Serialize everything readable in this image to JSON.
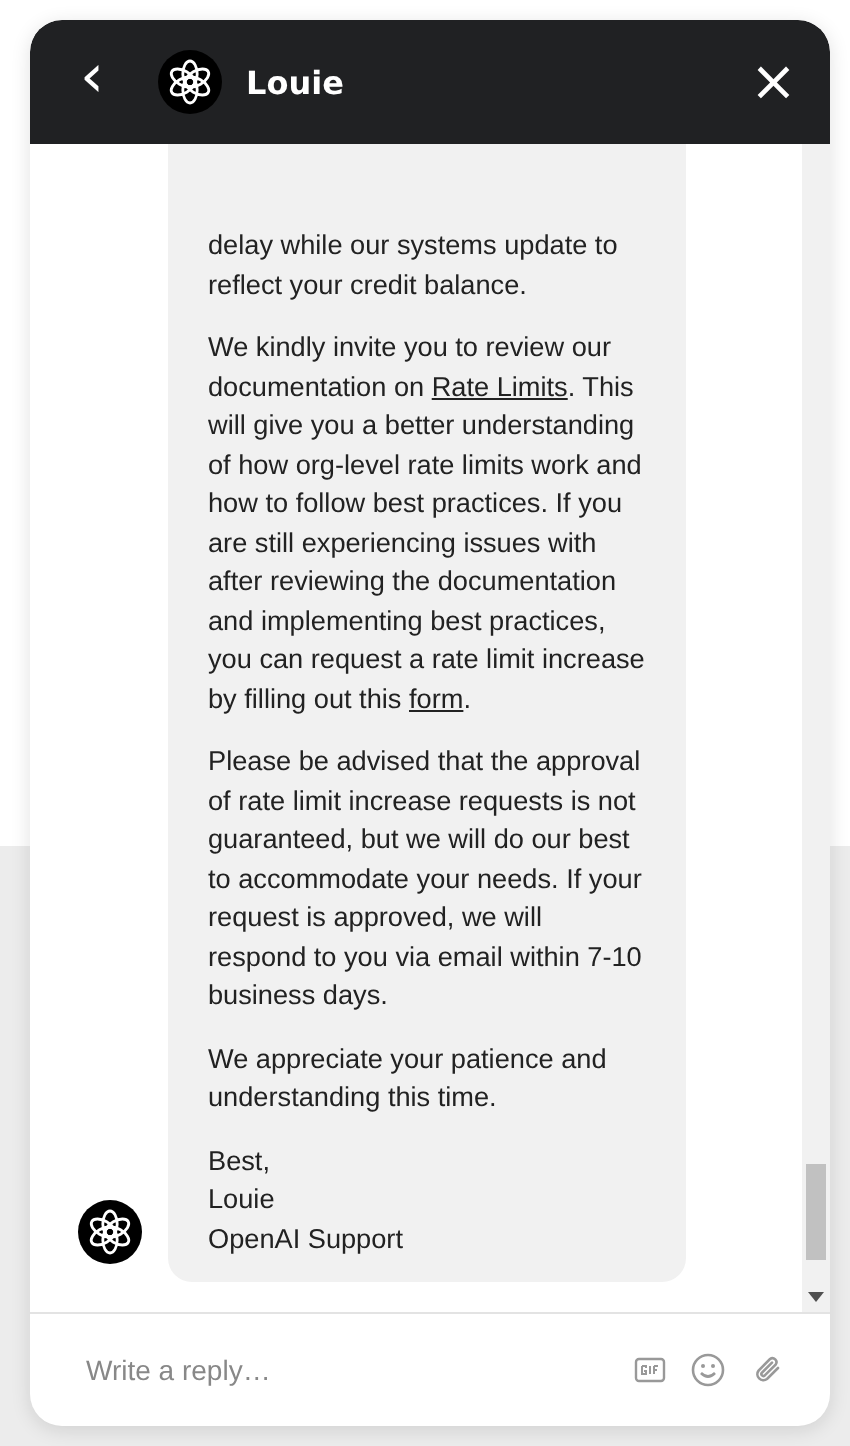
{
  "header": {
    "back": "‹",
    "title": "Louie",
    "close": "×"
  },
  "message": {
    "paragraphs": [
      [
        {
          "text": "delay while our systems update to reflect your credit balance."
        }
      ],
      [
        {
          "text": "We kindly invite you to review our documentation on "
        },
        {
          "text": "Rate Limits",
          "kind": "link"
        },
        {
          "text": ". This will give you a better understanding of how org-level rate limits work and how to follow best practices. If you are still experiencing issues with after reviewing the documentation and implementing best practices, you can request a rate limit increase by filling out this "
        },
        {
          "text": "form",
          "kind": "link"
        },
        {
          "text": "."
        }
      ],
      [
        {
          "text": "Please be advised that the approval of rate limit increase requests is not guaranteed, but we will do our best to accommodate your needs. If your request is approved, we will respond to you via email within 7-10 business days."
        }
      ],
      [
        {
          "text": "We appreciate your patience and understanding this time."
        }
      ],
      [
        {
          "text": "Best,"
        },
        {
          "kind": "break"
        },
        {
          "text": "Louie"
        },
        {
          "kind": "break"
        },
        {
          "text": "OpenAI Support"
        }
      ]
    ]
  },
  "composer": {
    "placeholder": "Write a reply…"
  }
}
